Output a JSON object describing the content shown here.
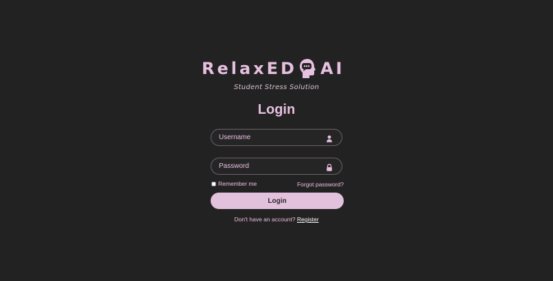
{
  "brand": {
    "name_part1": "RelaxED",
    "name_part2": "AI",
    "tagline": "Student Stress Solution",
    "icon": "head-with-speech-bubble-icon"
  },
  "form": {
    "title": "Login",
    "username": {
      "placeholder": "Username",
      "value": "",
      "icon": "user-icon"
    },
    "password": {
      "placeholder": "Password",
      "value": "",
      "icon": "lock-icon"
    },
    "remember_label": "Remember me",
    "remember_checked": false,
    "forgot_label": "Forgot password?",
    "submit_label": "Login",
    "register_prompt": "Don't have an account?",
    "register_label": "Register"
  },
  "colors": {
    "background": "#232223",
    "accent": "#e6c0df",
    "button": "#e2c1dc"
  }
}
